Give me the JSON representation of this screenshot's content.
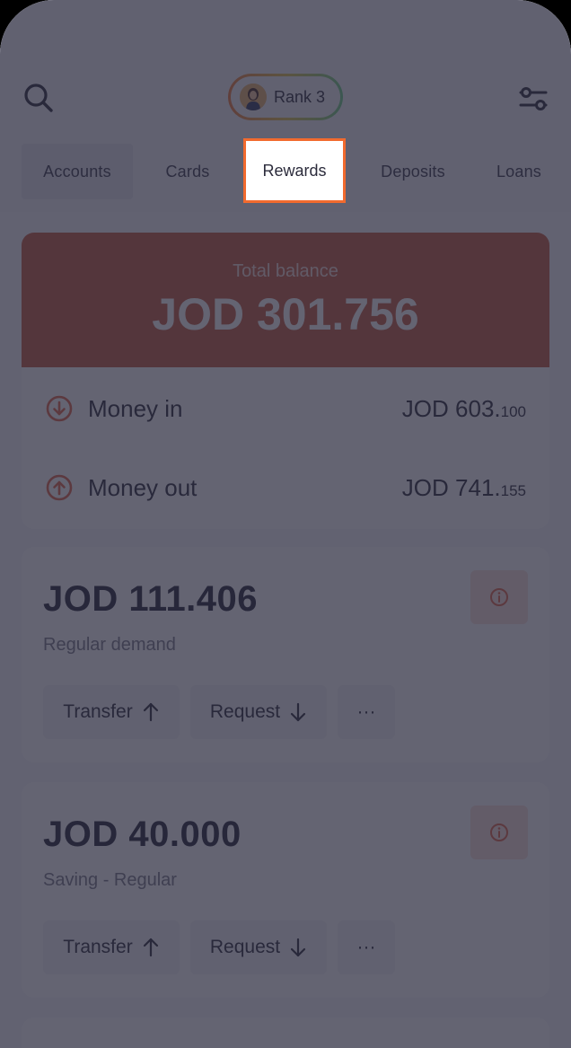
{
  "header": {
    "rank_label": "Rank 3"
  },
  "tabs": [
    {
      "label": "Accounts"
    },
    {
      "label": "Cards"
    },
    {
      "label": "Rewards"
    },
    {
      "label": "Deposits"
    },
    {
      "label": "Loans"
    }
  ],
  "balance": {
    "label": "Total balance",
    "value": "JOD 301.756"
  },
  "flows": {
    "money_in": {
      "label": "Money in",
      "amount_main": "JOD 603.",
      "amount_dec": "100"
    },
    "money_out": {
      "label": "Money out",
      "amount_main": "JOD 741.",
      "amount_dec": "155"
    }
  },
  "accounts": [
    {
      "amount": "JOD 111.406",
      "type": "Regular demand",
      "transfer_label": "Transfer",
      "request_label": "Request"
    },
    {
      "amount": "JOD 40.000",
      "type": "Saving - Regular",
      "transfer_label": "Transfer",
      "request_label": "Request"
    }
  ],
  "more_label": "···",
  "colors": {
    "accent": "#c75a3f",
    "highlight_border": "#f26a2e",
    "overlay": "#28283c"
  },
  "icons": [
    "search-icon",
    "filter-icon",
    "avatar",
    "arrow-down-circle-icon",
    "arrow-up-circle-icon",
    "info-icon",
    "arrow-up-icon",
    "arrow-down-icon",
    "more-icon"
  ]
}
